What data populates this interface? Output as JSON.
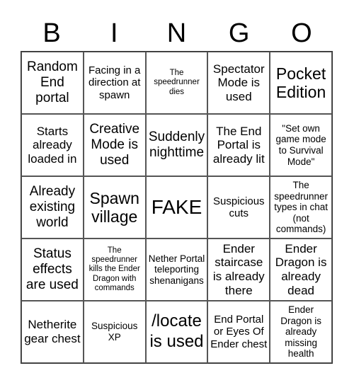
{
  "header": [
    "B",
    "I",
    "N",
    "G",
    "O"
  ],
  "cells": [
    [
      "Random End portal",
      "Facing in a direction at spawn",
      "The speedrunner dies",
      "Spectator Mode is used",
      "Pocket Edition"
    ],
    [
      "Starts already loaded in",
      "Creative Mode is used",
      "Suddenly nighttime",
      "The End Portal is already lit",
      "\"Set own game mode to Survival Mode\""
    ],
    [
      "Already existing world",
      "Spawn village",
      "FAKE",
      "Suspicious cuts",
      "The speedrunner types in chat (not commands)"
    ],
    [
      "Status effects are used",
      "The speedrunner kills the Ender Dragon with commands",
      "Nether Portal teleporting shenanigans",
      "Ender staircase is already there",
      "Ender Dragon is already dead"
    ],
    [
      "Netherite gear chest",
      "Suspicious XP",
      "/locate is used",
      "End Portal or Eyes Of Ender chest",
      "Ender Dragon is already missing health"
    ]
  ]
}
